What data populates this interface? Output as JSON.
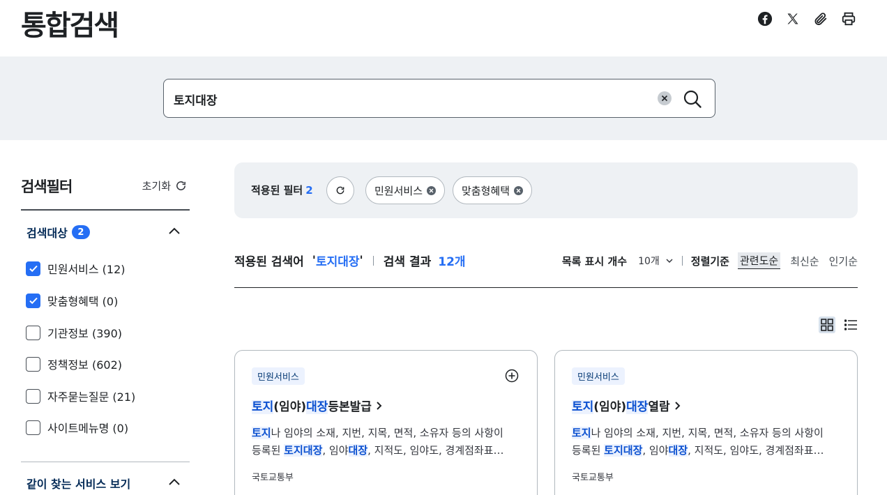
{
  "header": {
    "title": "통합검색",
    "share_icons": [
      "facebook-icon",
      "x-icon",
      "link-clip-icon",
      "print-icon"
    ]
  },
  "search": {
    "value": "토지대장"
  },
  "sidebar": {
    "title": "검색필터",
    "reset_label": "초기화",
    "groups": [
      {
        "title": "검색대상",
        "badge": "2",
        "items": [
          {
            "label": "민원서비스 (12)",
            "checked": true
          },
          {
            "label": "맞춤형혜택 (0)",
            "checked": true
          },
          {
            "label": "기관정보 (390)",
            "checked": false
          },
          {
            "label": "정책정보 (602)",
            "checked": false
          },
          {
            "label": "자주묻는질문 (21)",
            "checked": false
          },
          {
            "label": "사이트메뉴명 (0)",
            "checked": false
          }
        ]
      },
      {
        "title": "같이 찾는 서비스 보기"
      }
    ]
  },
  "applied_filters": {
    "label": "적용된 필터",
    "count": "2",
    "chips": [
      "민원서비스",
      "맞춤형혜택"
    ]
  },
  "summary": {
    "query_label": "적용된 검색어",
    "query_open": "'",
    "query": "토지대장",
    "query_close": "'",
    "result_label": "검색 결과",
    "result_count": "12개"
  },
  "sort": {
    "page_size_label": "목록 표시 개수",
    "page_size_value": "10개",
    "order_label": "정렬기준",
    "options": [
      "관련도순",
      "최신순",
      "인기순"
    ],
    "active": "관련도순"
  },
  "results": [
    {
      "tag": "민원서비스",
      "title_parts": [
        {
          "t": "토지",
          "hl": true
        },
        {
          "t": "(임야)",
          "hl": false
        },
        {
          "t": "대장",
          "hl": true
        },
        {
          "t": "등본발급",
          "hl": false
        }
      ],
      "desc_parts": [
        {
          "t": "토지",
          "hl": true
        },
        {
          "t": "나 임야의 소재, 지번, 지목, 면적, 소유자 등의 사항이 등록된 ",
          "hl": false
        },
        {
          "t": "토지대장",
          "hl": true
        },
        {
          "t": ", 임야",
          "hl": false
        },
        {
          "t": "대장",
          "hl": true
        },
        {
          "t": ", 지적도, 임야도, 경계점좌표…",
          "hl": false
        }
      ],
      "org": "국토교통부"
    },
    {
      "tag": "민원서비스",
      "title_parts": [
        {
          "t": "토지",
          "hl": true
        },
        {
          "t": "(임야)",
          "hl": false
        },
        {
          "t": "대장",
          "hl": true
        },
        {
          "t": "열람",
          "hl": false
        }
      ],
      "desc_parts": [
        {
          "t": "토지",
          "hl": true
        },
        {
          "t": "나 임야의 소재, 지번, 지목, 면적, 소유자 등의 사항이 등록된 ",
          "hl": false
        },
        {
          "t": "토지대장",
          "hl": true
        },
        {
          "t": ", 임야",
          "hl": false
        },
        {
          "t": "대장",
          "hl": true
        },
        {
          "t": ", 지적도, 임야도, 경계점좌표…",
          "hl": false
        }
      ],
      "org": "국토교통부"
    }
  ],
  "colors": {
    "accent": "#256ef4",
    "band": "#eef1f4",
    "highlight_bg": "#ecf2fe"
  }
}
